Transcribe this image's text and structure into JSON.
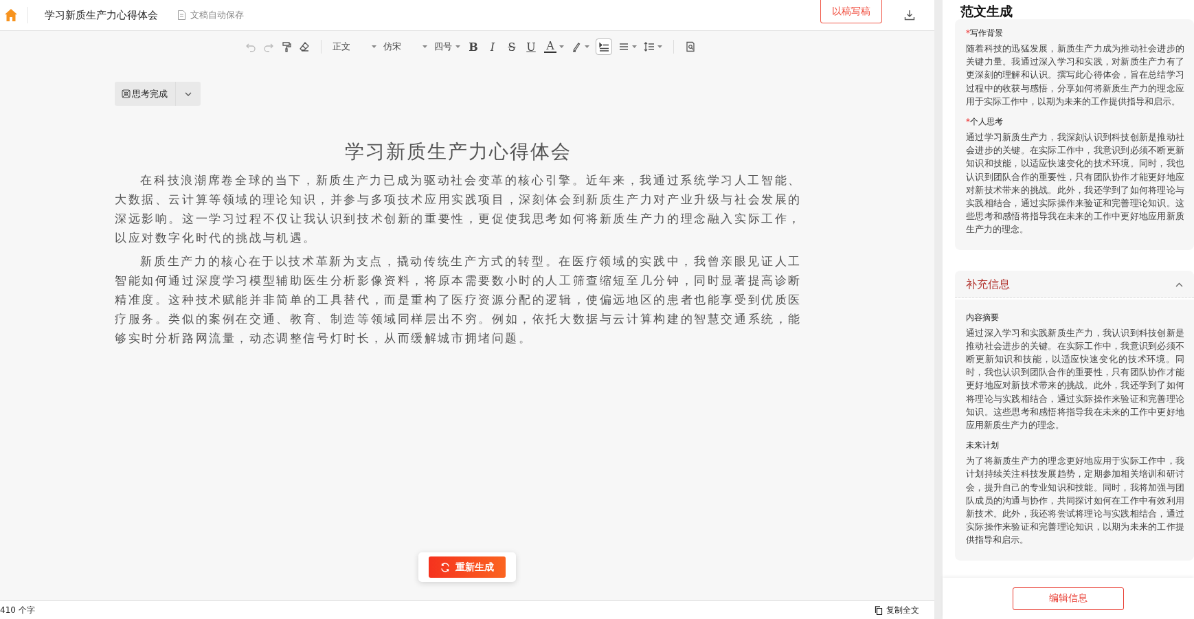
{
  "topbar": {
    "doc_title": "学习新质生产力心得体会",
    "autosave": "文稿自动保存",
    "write_button": "以稿写稿"
  },
  "toolbar": {
    "style": "正文",
    "font": "仿宋",
    "size": "四号",
    "format_buttons": [
      "B",
      "I",
      "S",
      "U",
      "A"
    ],
    "first_line_indent_on": true
  },
  "thinking": {
    "label": "思考完成"
  },
  "document": {
    "title": "学习新质生产力心得体会",
    "paragraphs": [
      "在科技浪潮席卷全球的当下，新质生产力已成为驱动社会变革的核心引擎。近年来，我通过系统学习人工智能、大数据、云计算等领域的理论知识，并参与多项技术应用实践项目，深刻体会到新质生产力对产业升级与社会发展的深远影响。这一学习过程不仅让我认识到技术创新的重要性，更促使我思考如何将新质生产力的理念融入实际工作，以应对数字化时代的挑战与机遇。",
      "新质生产力的核心在于以技术革新为支点，撬动传统生产方式的转型。在医疗领域的实践中，我曾亲眼见证人工智能如何通过深度学习模型辅助医生分析影像资料，将原本需要数小时的人工筛查缩短至几分钟，同时显著提高诊断精准度。这种技术赋能并非简单的工具替代，而是重构了医疗资源分配的逻辑，使偏远地区的患者也能享受到优质医疗服务。类似的案例在交通、教育、制造等领域同样层出不穷。例如，依托大数据与云计算构建的智慧交通系统，能够实时分析路网流量，动态调整信号灯时长，从而缓解城市拥堵问题。"
    ]
  },
  "regenerate_button": "重新生成",
  "status_bar": {
    "word_count": "410 个字",
    "copy_all": "复制全文"
  },
  "side_panel": {
    "title": "范文生成",
    "fields": [
      {
        "mark": "*",
        "label": "写作背景",
        "text": "随着科技的迅猛发展，新质生产力成为推动社会进步的关键力量。我通过深入学习和实践，对新质生产力有了更深刻的理解和认识。撰写此心得体会，旨在总结学习过程中的收获与感悟，分享如何将新质生产力的理念应用于实际工作中，以期为未来的工作提供指导和启示。"
      },
      {
        "mark": "*",
        "label": "个人思考",
        "text": "通过学习新质生产力，我深刻认识到科技创新是推动社会进步的关键。在实际工作中，我意识到必须不断更新知识和技能，以适应快速变化的技术环境。同时，我也认识到团队合作的重要性，只有团队协作才能更好地应对新技术带来的挑战。此外，我还学到了如何将理论与实践相结合，通过实际操作来验证和完善理论知识。这些思考和感悟将指导我在未来的工作中更好地应用新质生产力的理念。"
      }
    ],
    "supplement": {
      "title": "补充信息",
      "expanded": true,
      "fields": [
        {
          "label": "内容摘要",
          "text": "通过深入学习和实践新质生产力，我认识到科技创新是推动社会进步的关键。在实际工作中，我意识到必须不断更新知识和技能，以适应快速变化的技术环境。同时，我也认识到团队合作的重要性，只有团队协作才能更好地应对新技术带来的挑战。此外，我还学到了如何将理论与实践相结合，通过实际操作来验证和完善理论知识。这些思考和感悟将指导我在未来的工作中更好地应用新质生产力的理念。"
        },
        {
          "label": "未来计划",
          "text": "为了将新质生产力的理念更好地应用于实际工作中，我计划持续关注科技发展趋势，定期参加相关培训和研讨会，提升自己的专业知识和技能。同时，我将加强与团队成员的沟通与协作，共同探讨如何在工作中有效利用新技术。此外，我还将尝试将理论与实践相结合，通过实际操作来验证和完善理论知识，以期为未来的工作提供指导和启示。"
        }
      ]
    },
    "edit_button": "编辑信息"
  }
}
